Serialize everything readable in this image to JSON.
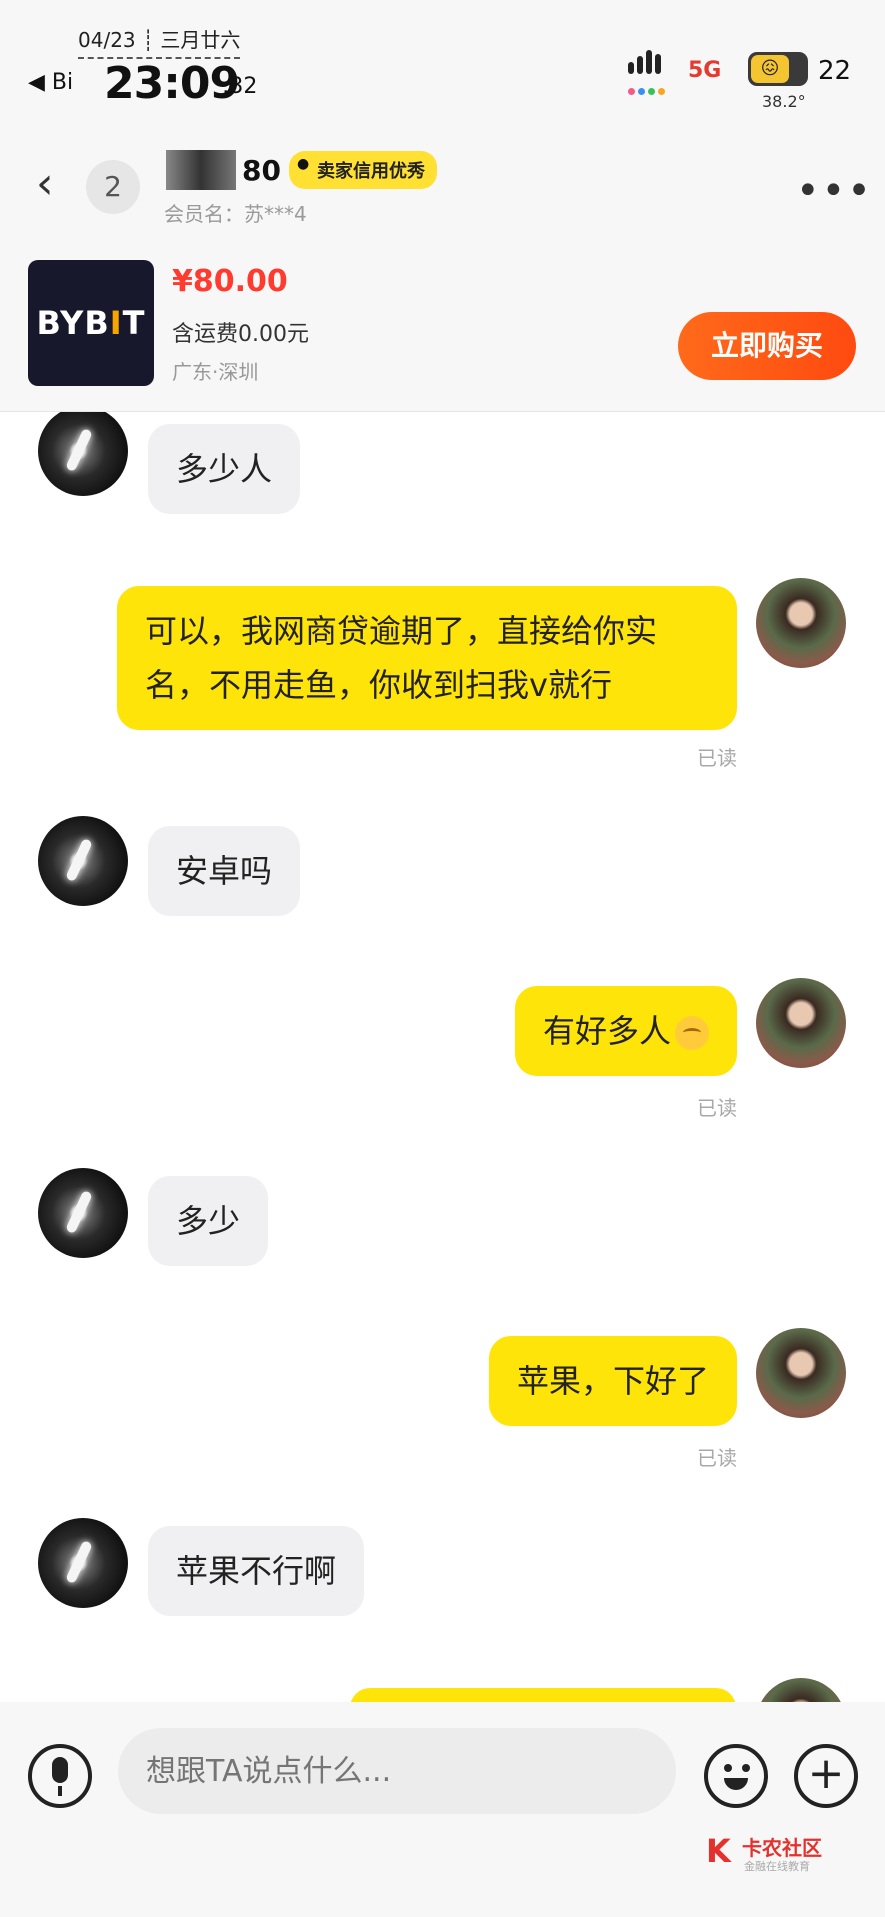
{
  "status_bar": {
    "date": "04/23 ┊ 三月廿六",
    "back_label": "◀ Bi",
    "time": "23:09",
    "seconds": ":32",
    "network": "5G",
    "battery_pct": "22",
    "temperature": "38.2°"
  },
  "header": {
    "back_icon": "‹",
    "unread_count": "2",
    "seller_name_suffix": "80",
    "credit_badge": "卖家信用优秀",
    "member_name": "会员名：苏***4",
    "more_icon": "•••"
  },
  "product": {
    "brand_prefix": "BYB",
    "brand_mark": "I",
    "brand_suffix": "T",
    "price": "¥80.00",
    "shipping": "含运费0.00元",
    "location": "广东·深圳",
    "buy_button": "立即购买"
  },
  "messages": [
    {
      "side": "peer",
      "text": "多少人"
    },
    {
      "side": "me",
      "text": "可以，我网商贷逾期了，直接给你实名，不用走鱼，你收到扫我v就行",
      "status": "已读"
    },
    {
      "side": "peer",
      "text": "安卓吗"
    },
    {
      "side": "me",
      "text": "有好多人",
      "status": "已读"
    },
    {
      "side": "peer",
      "text": "多少"
    },
    {
      "side": "me",
      "text": "苹果，下好了",
      "status": "已读"
    },
    {
      "side": "peer",
      "text": "苹果不行啊"
    }
  ],
  "input": {
    "placeholder": "想跟TA说点什么..."
  },
  "watermark": {
    "logo": "K",
    "title": "卡农社区",
    "subtitle": "金融在线教育"
  },
  "icons": {
    "mic": "microphone-icon",
    "emoji": "smiley-icon",
    "plus": "plus-icon"
  },
  "colors": {
    "my_bubble": "#ffe40a",
    "peer_bubble": "#f0f0f3",
    "price": "#ff3a2f",
    "buy_button": "#ff4a10"
  }
}
